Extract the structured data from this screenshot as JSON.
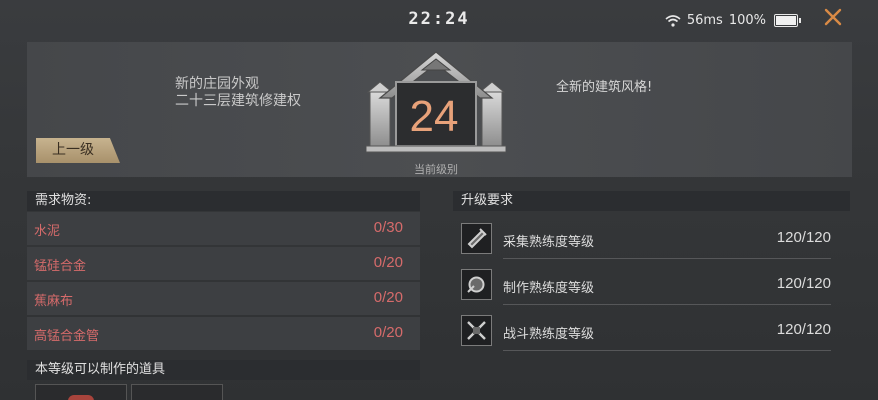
{
  "status": {
    "time": "22:24",
    "ping": "56ms",
    "battery": "100%",
    "battery_level": 1.0
  },
  "banner": {
    "line1": "新的庄园外观",
    "line2": "二十三层建筑修建权",
    "right_text": "全新的建筑风格!",
    "back_label": "上一级",
    "level": "24",
    "level_caption": "当前级别"
  },
  "materials": {
    "header": "需求物资:",
    "items": [
      {
        "name": "水泥",
        "qty": "0/30"
      },
      {
        "name": "锰硅合金",
        "qty": "0/20"
      },
      {
        "name": "蕉麻布",
        "qty": "0/20"
      },
      {
        "name": "高锰合金管",
        "qty": "0/20"
      }
    ]
  },
  "requirements": {
    "header": "升级要求",
    "items": [
      {
        "name": "采集熟练度等级",
        "value": "120/120",
        "icon": "gather-icon"
      },
      {
        "name": "制作熟练度等级",
        "value": "120/120",
        "icon": "craft-icon"
      },
      {
        "name": "战斗熟练度等级",
        "value": "120/120",
        "icon": "combat-icon"
      }
    ]
  },
  "craftable": {
    "header": "本等级可以制作的道具"
  },
  "colors": {
    "accent": "#d98a45",
    "level_number": "#e8a27a",
    "shortage": "#d66b6b"
  }
}
